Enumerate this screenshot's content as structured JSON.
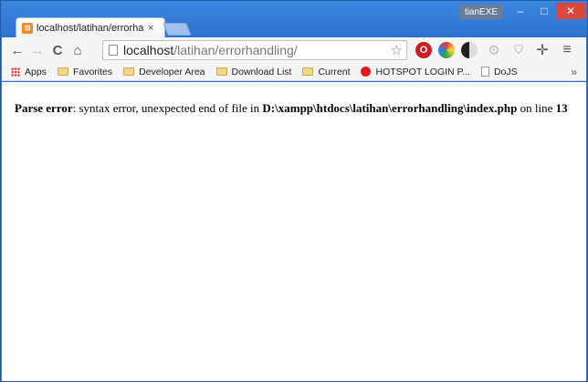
{
  "browser": {
    "tab_title": "localhost/latihan/errorha",
    "tab_close": "×",
    "profile_name": "tianEXE",
    "window_controls": {
      "minimize": "–",
      "maximize": "□",
      "close": "✕"
    }
  },
  "toolbar": {
    "back": "←",
    "forward": "→",
    "reload": "C",
    "home": "⌂",
    "url_host": "localhost",
    "url_path": "/latihan/errorhandling/",
    "star": "☆",
    "extensions": [
      "opera-icon",
      "color-picker-icon",
      "night-mode-icon",
      "gear-icon",
      "shield-icon",
      "move-icon"
    ],
    "menu": "≡"
  },
  "bookmarks": {
    "items": [
      {
        "label": "Apps",
        "icon": "apps-icon"
      },
      {
        "label": "Favorites",
        "icon": "folder-icon"
      },
      {
        "label": "Developer Area",
        "icon": "folder-icon"
      },
      {
        "label": "Download List",
        "icon": "folder-icon"
      },
      {
        "label": "Current",
        "icon": "folder-icon"
      },
      {
        "label": "HOTSPOT LOGIN P...",
        "icon": "red-dot-icon"
      },
      {
        "label": "DoJS",
        "icon": "page-icon"
      }
    ],
    "more": "»"
  },
  "page": {
    "error_label": "Parse error",
    "error_message": ": syntax error, unexpected end of file in ",
    "file_path": "D:\\xampp\\htdocs\\latihan\\errorhandling\\index.php",
    "on_line_text": " on line ",
    "line_number": "13"
  }
}
